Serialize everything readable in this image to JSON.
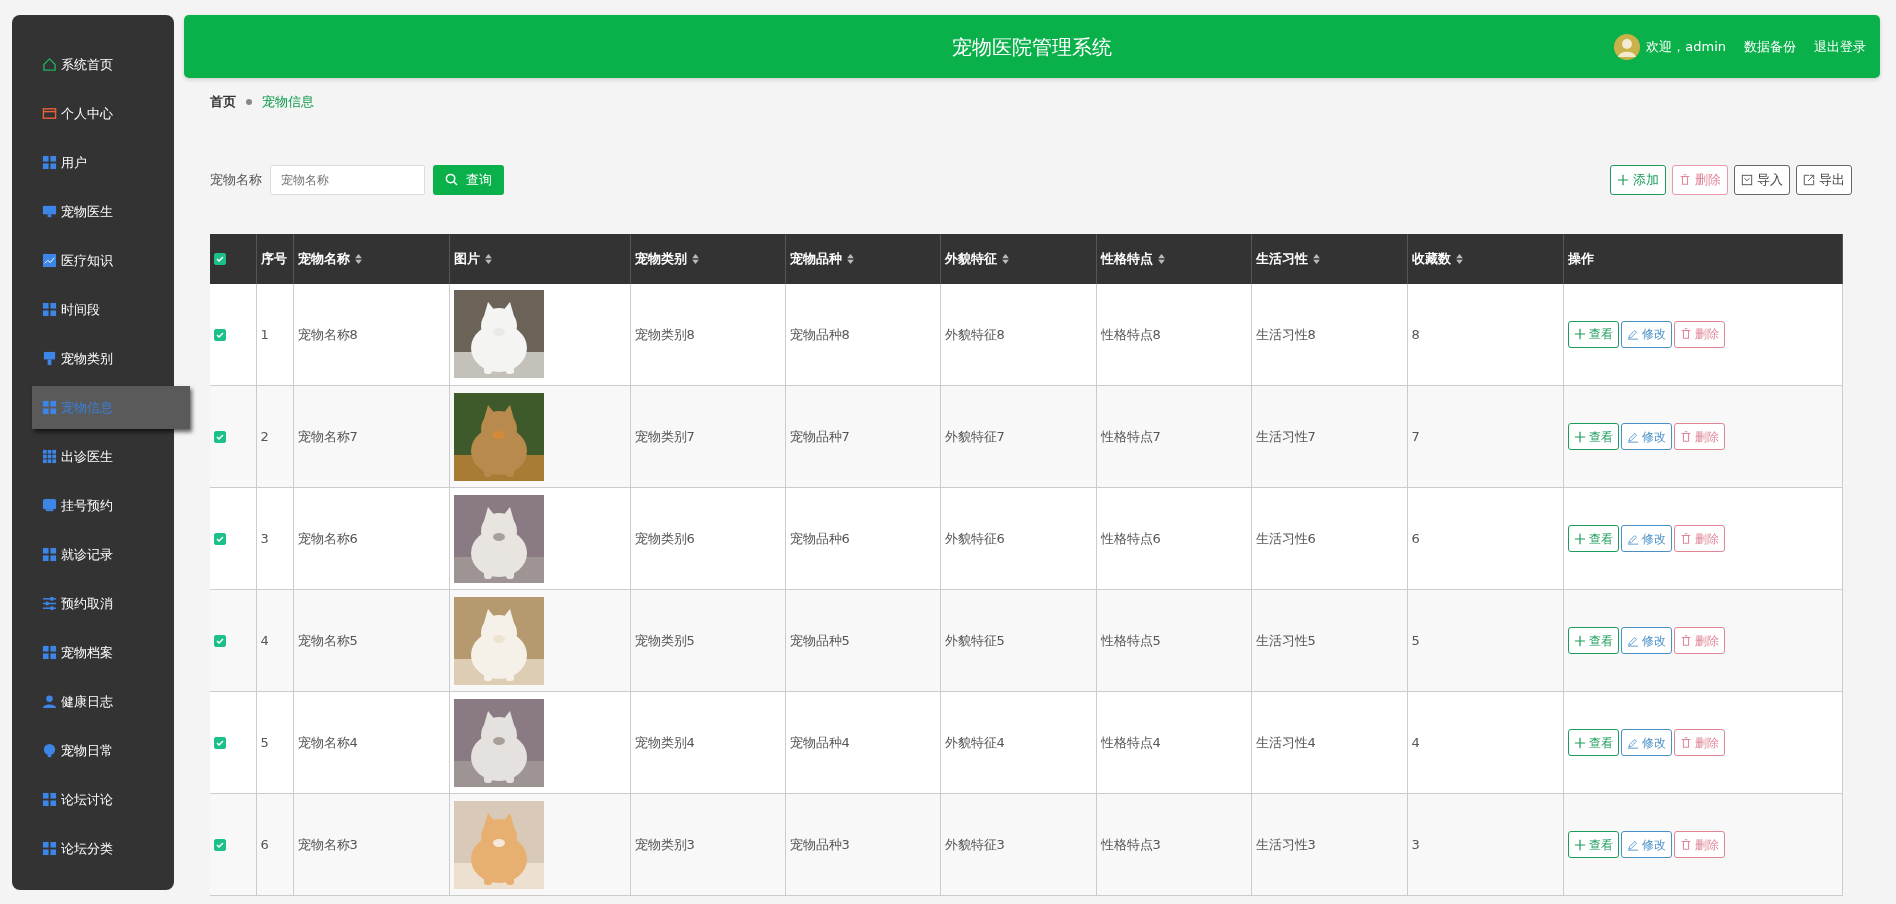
{
  "sidebar": {
    "items": [
      {
        "label": "系统首页",
        "selected": false
      },
      {
        "label": "个人中心",
        "selected": false
      },
      {
        "label": "用户",
        "selected": false
      },
      {
        "label": "宠物医生",
        "selected": false
      },
      {
        "label": "医疗知识",
        "selected": false
      },
      {
        "label": "时间段",
        "selected": false
      },
      {
        "label": "宠物类别",
        "selected": false
      },
      {
        "label": "宠物信息",
        "selected": true
      },
      {
        "label": "出诊医生",
        "selected": false
      },
      {
        "label": "挂号预约",
        "selected": false
      },
      {
        "label": "就诊记录",
        "selected": false
      },
      {
        "label": "预约取消",
        "selected": false
      },
      {
        "label": "宠物档案",
        "selected": false
      },
      {
        "label": "健康日志",
        "selected": false
      },
      {
        "label": "宠物日常",
        "selected": false
      },
      {
        "label": "论坛讨论",
        "selected": false
      },
      {
        "label": "论坛分类",
        "selected": false
      }
    ]
  },
  "header": {
    "title": "宠物医院管理系统",
    "greeting": "欢迎，admin",
    "links": [
      "数据备份",
      "退出登录"
    ]
  },
  "breadcrumb": [
    "首页",
    "宠物信息"
  ],
  "search": {
    "label": "宠物名称",
    "placeholder": "宠物名称",
    "button": "查询"
  },
  "toolbar": [
    {
      "label": "添加",
      "kind": "add"
    },
    {
      "label": "删除",
      "kind": "delete"
    },
    {
      "label": "导入",
      "kind": "import"
    },
    {
      "label": "导出",
      "kind": "export"
    }
  ],
  "table": {
    "all_checked": true,
    "columns": [
      {
        "label": "序号",
        "sortable": false
      },
      {
        "label": "宠物名称",
        "sortable": true
      },
      {
        "label": "图片",
        "sortable": true
      },
      {
        "label": "宠物类别",
        "sortable": true
      },
      {
        "label": "宠物品种",
        "sortable": true
      },
      {
        "label": "外貌特征",
        "sortable": true
      },
      {
        "label": "性格特点",
        "sortable": true
      },
      {
        "label": "生活习性",
        "sortable": true
      },
      {
        "label": "收藏数",
        "sortable": true
      },
      {
        "label": "操作",
        "sortable": false
      }
    ],
    "rows": [
      {
        "checked": true,
        "cells": [
          {
            "text": "1"
          },
          {
            "text": "宠物名称8"
          },
          {
            "kind": "picture"
          },
          {
            "text": "宠物类别8"
          },
          {
            "text": "宠物品种8"
          },
          {
            "text": "外貌特征8"
          },
          {
            "text": "性格特点8"
          },
          {
            "text": "生活习性8"
          },
          {
            "text": "8"
          },
          {
            "actions": [
              {
                "label": "查看",
                "kind": "view"
              },
              {
                "label": "修改",
                "kind": "edit"
              },
              {
                "label": "删除",
                "kind": "delete"
              }
            ]
          }
        ]
      },
      {
        "checked": true,
        "cells": [
          {
            "text": "2"
          },
          {
            "text": "宠物名称7"
          },
          {
            "kind": "picture"
          },
          {
            "text": "宠物类别7"
          },
          {
            "text": "宠物品种7"
          },
          {
            "text": "外貌特征7"
          },
          {
            "text": "性格特点7"
          },
          {
            "text": "生活习性7"
          },
          {
            "text": "7"
          },
          {
            "actions": [
              {
                "label": "查看",
                "kind": "view"
              },
              {
                "label": "修改",
                "kind": "edit"
              },
              {
                "label": "删除",
                "kind": "delete"
              }
            ]
          }
        ]
      },
      {
        "checked": true,
        "cells": [
          {
            "text": "3"
          },
          {
            "text": "宠物名称6"
          },
          {
            "kind": "picture"
          },
          {
            "text": "宠物类别6"
          },
          {
            "text": "宠物品种6"
          },
          {
            "text": "外貌特征6"
          },
          {
            "text": "性格特点6"
          },
          {
            "text": "生活习性6"
          },
          {
            "text": "6"
          },
          {
            "actions": [
              {
                "label": "查看",
                "kind": "view"
              },
              {
                "label": "修改",
                "kind": "edit"
              },
              {
                "label": "删除",
                "kind": "delete"
              }
            ]
          }
        ]
      },
      {
        "checked": true,
        "cells": [
          {
            "text": "4"
          },
          {
            "text": "宠物名称5"
          },
          {
            "kind": "picture"
          },
          {
            "text": "宠物类别5"
          },
          {
            "text": "宠物品种5"
          },
          {
            "text": "外貌特征5"
          },
          {
            "text": "性格特点5"
          },
          {
            "text": "生活习性5"
          },
          {
            "text": "5"
          },
          {
            "actions": [
              {
                "label": "查看",
                "kind": "view"
              },
              {
                "label": "修改",
                "kind": "edit"
              },
              {
                "label": "删除",
                "kind": "delete"
              }
            ]
          }
        ]
      },
      {
        "checked": true,
        "cells": [
          {
            "text": "5"
          },
          {
            "text": "宠物名称4"
          },
          {
            "kind": "picture"
          },
          {
            "text": "宠物类别4"
          },
          {
            "text": "宠物品种4"
          },
          {
            "text": "外貌特征4"
          },
          {
            "text": "性格特点4"
          },
          {
            "text": "生活习性4"
          },
          {
            "text": "4"
          },
          {
            "actions": [
              {
                "label": "查看",
                "kind": "view"
              },
              {
                "label": "修改",
                "kind": "edit"
              },
              {
                "label": "删除",
                "kind": "delete"
              }
            ]
          }
        ]
      },
      {
        "checked": true,
        "cells": [
          {
            "text": "6"
          },
          {
            "text": "宠物名称3"
          },
          {
            "kind": "picture"
          },
          {
            "text": "宠物类别3"
          },
          {
            "text": "宠物品种3"
          },
          {
            "text": "外貌特征3"
          },
          {
            "text": "性格特点3"
          },
          {
            "text": "生活习性3"
          },
          {
            "text": "3"
          },
          {
            "actions": [
              {
                "label": "查看",
                "kind": "view"
              },
              {
                "label": "修改",
                "kind": "edit"
              },
              {
                "label": "删除",
                "kind": "delete"
              }
            ]
          }
        ]
      }
    ]
  }
}
